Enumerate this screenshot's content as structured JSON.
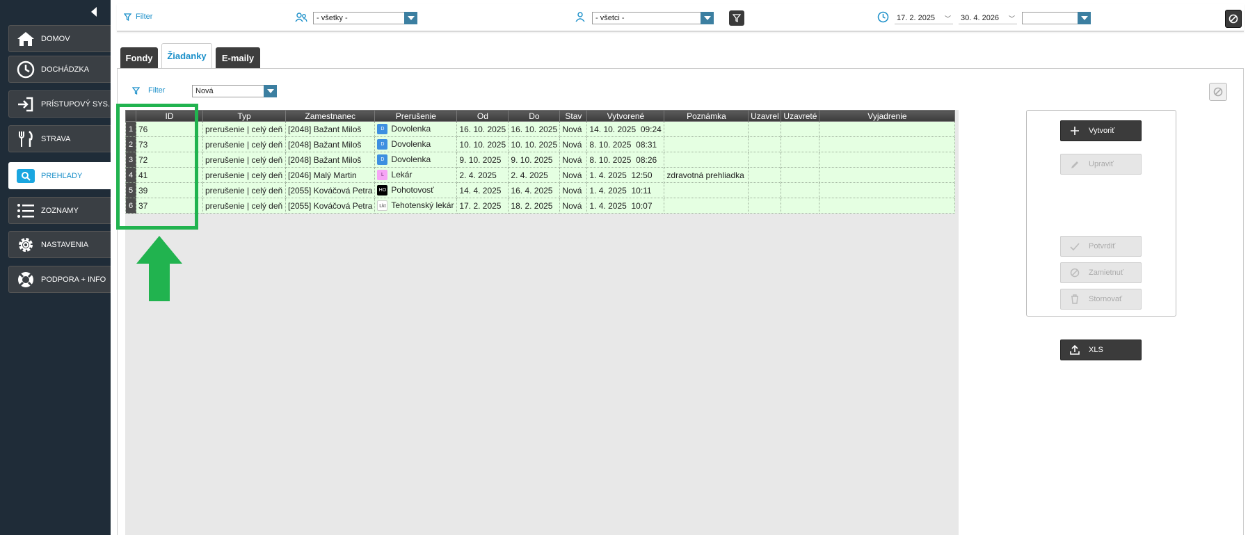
{
  "sidebar": {
    "items": [
      {
        "label": "DOMOV",
        "icon": "home-icon"
      },
      {
        "label": "DOCHÁDZKA",
        "icon": "clock-icon"
      },
      {
        "label": "PRÍSTUPOVÝ SYS.",
        "icon": "enter-icon"
      },
      {
        "label": "STRAVA",
        "icon": "cutlery-icon"
      },
      {
        "label": "PREHĽADY",
        "icon": "search-icon"
      },
      {
        "label": "ZOZNAMY",
        "icon": "list-icon"
      },
      {
        "label": "NASTAVENIA",
        "icon": "gear-icon"
      },
      {
        "label": "PODPORA + INFO",
        "icon": "lifebuoy-icon"
      }
    ],
    "active": "PREHĽADY"
  },
  "topbar": {
    "filter_label": "Filter",
    "group_select": "- všetky -",
    "person_select": "- všetci -",
    "date_from": "17. 2. 2025",
    "date_to": "30. 4. 2026",
    "extra_select": ""
  },
  "tabs": [
    {
      "label": "Fondy"
    },
    {
      "label": "Žiadanky"
    },
    {
      "label": "E-maily"
    }
  ],
  "panel": {
    "filter_label": "Filter",
    "status_select": "Nová"
  },
  "table": {
    "headers": [
      "ID",
      "Typ",
      "Zamestnanec",
      "Prerušenie",
      "Od",
      "Do",
      "Stav",
      "Vytvorené",
      "Poznámka",
      "Uzavrel",
      "Uzavreté",
      "Vyjadrenie"
    ],
    "rows": [
      {
        "n": "1",
        "id": "76",
        "typ": "prerušenie | celý deň",
        "zam": "[2048] Bažant Miloš",
        "icon": "D",
        "pre": "Dovolenka",
        "od": "16. 10. 2025",
        "do": "16. 10. 2025",
        "stav": "Nová",
        "vytv": "14. 10. 2025  09:24",
        "pozn": "",
        "uzavrel": "",
        "uzavrete": "",
        "vyj": ""
      },
      {
        "n": "2",
        "id": "73",
        "typ": "prerušenie | celý deň",
        "zam": "[2048] Bažant Miloš",
        "icon": "D",
        "pre": "Dovolenka",
        "od": "10. 10. 2025",
        "do": "10. 10. 2025",
        "stav": "Nová",
        "vytv": "8. 10. 2025  08:31",
        "pozn": "",
        "uzavrel": "",
        "uzavrete": "",
        "vyj": ""
      },
      {
        "n": "3",
        "id": "72",
        "typ": "prerušenie | celý deň",
        "zam": "[2048] Bažant Miloš",
        "icon": "D",
        "pre": "Dovolenka",
        "od": "9. 10. 2025",
        "do": "9. 10. 2025",
        "stav": "Nová",
        "vytv": "8. 10. 2025  08:26",
        "pozn": "",
        "uzavrel": "",
        "uzavrete": "",
        "vyj": ""
      },
      {
        "n": "4",
        "id": "41",
        "typ": "prerušenie | celý deň",
        "zam": "[2046] Malý Martin",
        "icon": "L",
        "pre": "Lekár",
        "od": "2. 4. 2025",
        "do": "2. 4. 2025",
        "stav": "Nová",
        "vytv": "1. 4. 2025  12:50",
        "pozn": "zdravotná prehliadka",
        "uzavrel": "",
        "uzavrete": "",
        "vyj": ""
      },
      {
        "n": "5",
        "id": "39",
        "typ": "prerušenie | celý deň",
        "zam": "[2055] Kováčová Petra",
        "icon": "HO",
        "pre": "Pohotovosť",
        "od": "14. 4. 2025",
        "do": "16. 4. 2025",
        "stav": "Nová",
        "vytv": "1. 4. 2025  10:11",
        "pozn": "",
        "uzavrel": "",
        "uzavrete": "",
        "vyj": ""
      },
      {
        "n": "6",
        "id": "37",
        "typ": "prerušenie | celý deň",
        "zam": "[2055] Kováčová Petra",
        "icon": "Lkt",
        "pre": "Tehotenský lekár",
        "od": "17. 2. 2025",
        "do": "18. 2. 2025",
        "stav": "Nová",
        "vytv": "1. 4. 2025  10:07",
        "pozn": "",
        "uzavrel": "",
        "uzavrete": "",
        "vyj": ""
      }
    ]
  },
  "actions": {
    "create": "Vytvoriť",
    "edit": "Upraviť",
    "confirm": "Potvrdiť",
    "reject": "Zamietnuť",
    "cancel": "Stornovať",
    "export": "XLS"
  },
  "colors": {
    "accent": "#1a8fc9",
    "sidebar_bg": "#1f2c38",
    "row_bg": "#e5ffe2",
    "highlight": "#21b34f"
  }
}
